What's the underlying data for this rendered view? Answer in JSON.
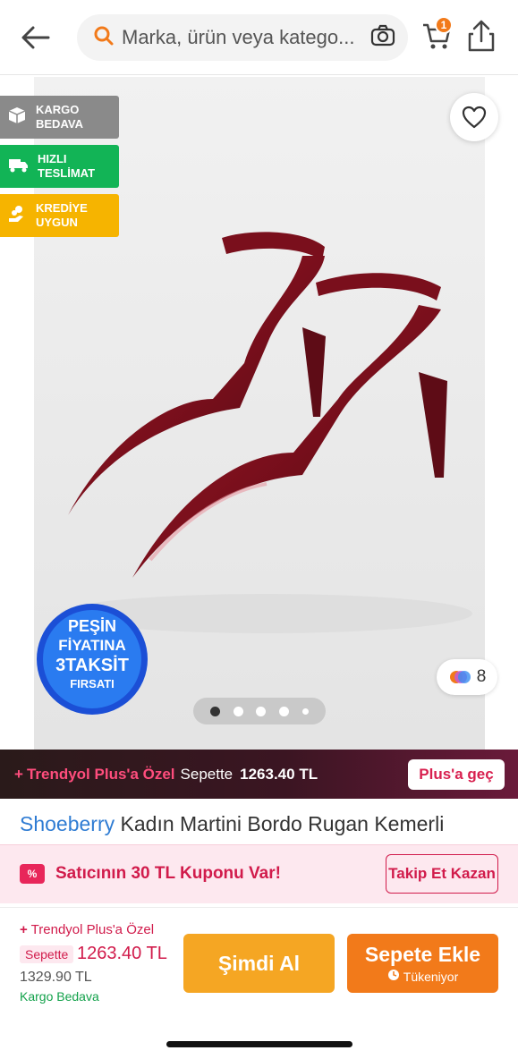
{
  "header": {
    "search_placeholder": "Marka, ürün veya katego...",
    "cart_count": "1"
  },
  "badges": [
    {
      "label": "KARGO BEDAVA",
      "line1": "KARGO",
      "line2": "BEDAVA",
      "color": "#8a8a8a"
    },
    {
      "label": "HIZLI TESLİMAT",
      "line1": "HIZLI",
      "line2": "TESLİMAT",
      "color": "#12b456"
    },
    {
      "label": "KREDİYE UYGUN",
      "line1": "KREDİYE",
      "line2": "UYGUN",
      "color": "#f6b400"
    }
  ],
  "gallery": {
    "promo_line1": "PEŞİN",
    "promo_line2": "FİYATINA",
    "promo_line3": "3TAKSİT",
    "promo_line4": "FIRSATI",
    "review_count": "8",
    "dot_count": 5,
    "active_dot": 0
  },
  "plus_band": {
    "label": "Trendyol Plus'a Özel",
    "sepette": "Sepette",
    "price": "1263.40 TL",
    "button": "Plus'a geç"
  },
  "product": {
    "brand": "Shoeberry",
    "name": "Kadın Martini Bordo Rugan Kemerli"
  },
  "coupon": {
    "icon_text": "%",
    "text": "Satıcının 30 TL Kuponu Var!",
    "button": "Takip Et Kazan"
  },
  "bottom_bar": {
    "plus_label": "Trendyol Plus'a Özel",
    "sepette": "Sepette",
    "price": "1263.40 TL",
    "old_price": "1329.90 TL",
    "shipping": "Kargo Bedava",
    "buy_now": "Şimdi Al",
    "add_to_cart": "Sepete Ekle",
    "stock_note": "Tükeniyor"
  },
  "colors": {
    "brand_orange": "#f27a1a",
    "plus_pink": "#d11b4b",
    "brand_link": "#2f7cd3"
  }
}
